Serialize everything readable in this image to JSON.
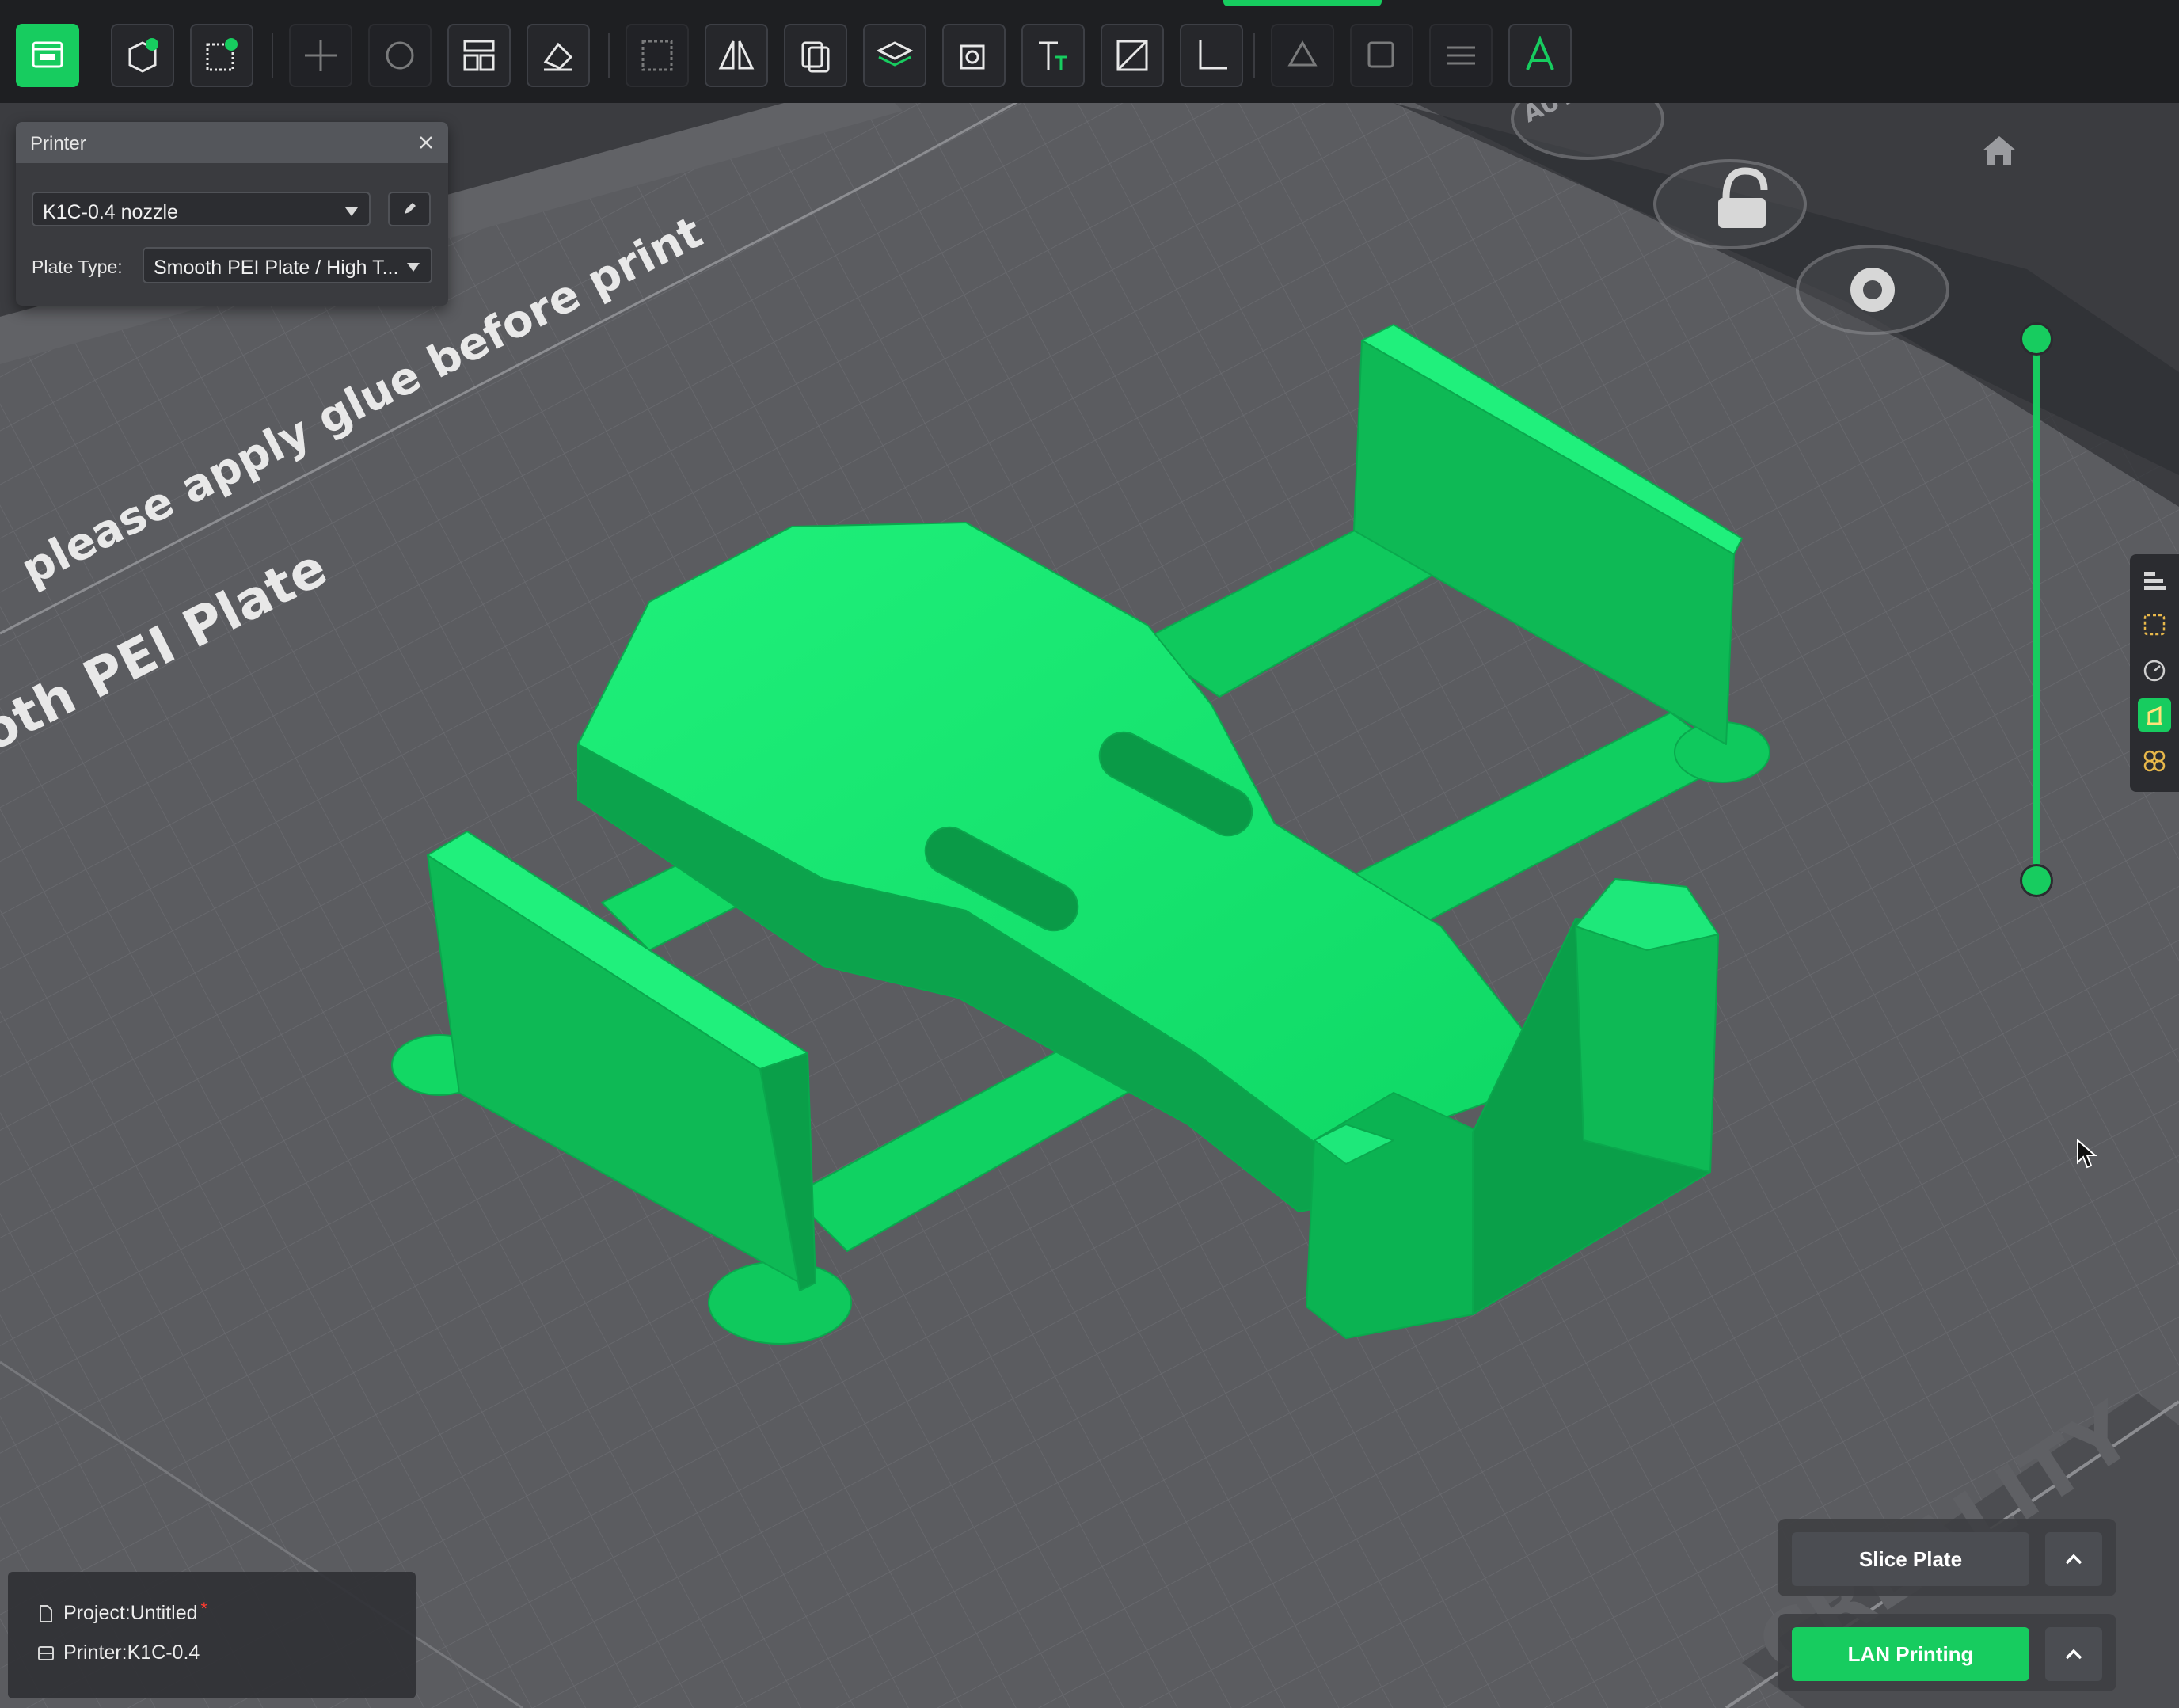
{
  "toolbar": {
    "tools": [
      {
        "name": "prepare-view-icon",
        "active": true
      },
      {
        "name": "add-object-icon"
      },
      {
        "name": "add-plate-icon"
      },
      {
        "name": "move-icon",
        "dim": true
      },
      {
        "name": "rotate-icon",
        "dim": true
      },
      {
        "name": "arrange-icon"
      },
      {
        "name": "lay-on-face-icon"
      },
      {
        "name": "scale-icon",
        "dim": true
      },
      {
        "name": "mirror-icon"
      },
      {
        "name": "split-icon"
      },
      {
        "name": "support-painting-icon"
      },
      {
        "name": "hollow-icon"
      },
      {
        "name": "text-icon"
      },
      {
        "name": "cut-icon"
      },
      {
        "name": "measure-icon"
      },
      {
        "name": "seam-painting-icon",
        "dim": true
      },
      {
        "name": "assembly-icon",
        "dim": true
      },
      {
        "name": "layers-icon",
        "dim": true
      },
      {
        "name": "font-icon"
      }
    ]
  },
  "printer_panel": {
    "title": "Printer",
    "printer_value": "K1C-0.4 nozzle",
    "plate_type_label": "Plate Type:",
    "plate_type_value": "Smooth PEI Plate / High T..."
  },
  "plate": {
    "glue_notice": "please apply glue before print",
    "plate_name": "oth PEI Plate",
    "brand": "CREALITY",
    "auto_label": "AUTO"
  },
  "info": {
    "project_label": "Project:Untitled",
    "dirty_mark": "*",
    "printer_label": "Printer:K1C-0.4"
  },
  "actions": {
    "slice_label": "Slice Plate",
    "print_label": "LAN Printing"
  },
  "slider": {
    "top_level": 1.0,
    "bottom_level": 0.0
  },
  "colors": {
    "accent": "#17cc5f",
    "model": "#12e06a",
    "plate": "#5c5d61",
    "toolbar": "#1e1f22"
  }
}
